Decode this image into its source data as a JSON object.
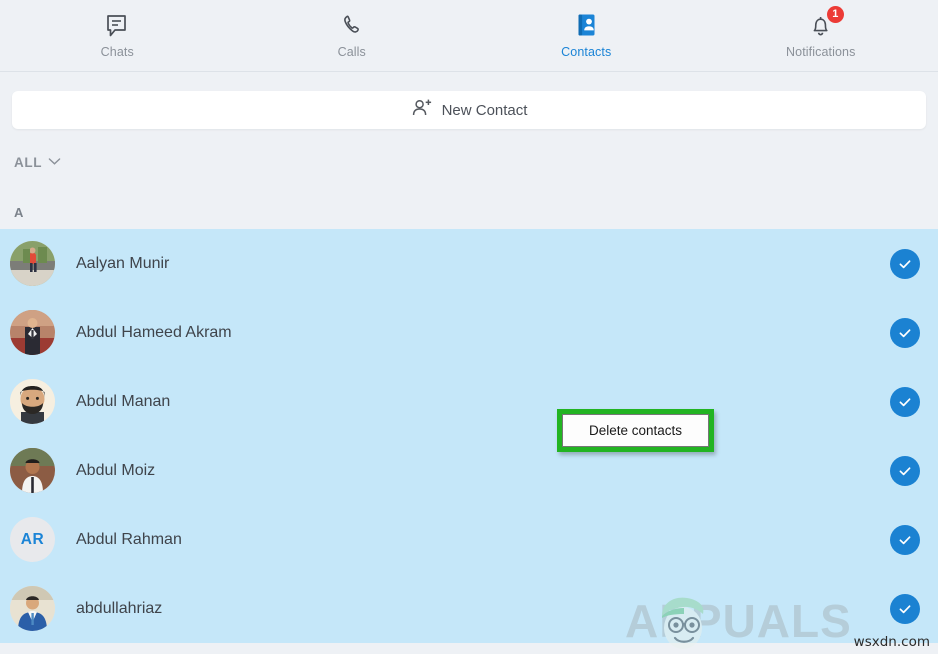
{
  "nav": {
    "items": [
      {
        "label": "Chats",
        "icon": "chat-icon",
        "active": false,
        "badge": null
      },
      {
        "label": "Calls",
        "icon": "phone-icon",
        "active": false,
        "badge": null
      },
      {
        "label": "Contacts",
        "icon": "contacts-book-icon",
        "active": true,
        "badge": null
      },
      {
        "label": "Notifications",
        "icon": "bell-icon",
        "active": false,
        "badge": "1"
      }
    ],
    "active_color": "#1b84d6",
    "inactive_color": "#8b9199",
    "badge_color": "#ec3b36"
  },
  "new_contact": {
    "label": "New Contact",
    "icon": "person-add-icon"
  },
  "filter": {
    "label": "ALL",
    "icon": "chevron-down-icon"
  },
  "section": {
    "letter": "A"
  },
  "contacts": [
    {
      "name": "Aalyan Munir",
      "avatar_type": "photo",
      "selected": true
    },
    {
      "name": "Abdul Hameed Akram",
      "avatar_type": "photo",
      "selected": true
    },
    {
      "name": "Abdul Manan",
      "avatar_type": "photo",
      "selected": true
    },
    {
      "name": "Abdul Moiz",
      "avatar_type": "photo",
      "selected": true
    },
    {
      "name": "Abdul Rahman",
      "avatar_type": "initials",
      "initials": "AR",
      "selected": true
    },
    {
      "name": "abdullahriaz",
      "avatar_type": "photo",
      "selected": true
    }
  ],
  "selection": {
    "row_background": "#c5e7f9",
    "check_color": "#1b82d2"
  },
  "tooltip": {
    "text": "Delete contacts",
    "highlight_color": "#22b422"
  },
  "watermarks": {
    "brand": "APPUALS",
    "site": "wsxdn.com"
  }
}
